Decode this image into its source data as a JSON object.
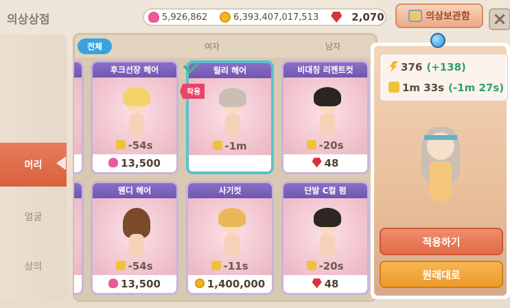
{
  "header": {
    "title": "의상상점",
    "hearts": "5,926,862",
    "coins": "6,393,407,017,513",
    "rubies": "2,070",
    "storage_label": "의상보관함",
    "close_symbol": "×"
  },
  "sidebar": {
    "items": [
      {
        "label": "머리",
        "active": true
      },
      {
        "label": "얼굴",
        "active": false
      },
      {
        "label": "상의",
        "active": false
      }
    ]
  },
  "tabs": [
    {
      "label": "전체",
      "active": true
    },
    {
      "label": "여자",
      "active": false
    },
    {
      "label": "남자",
      "active": false
    }
  ],
  "items": [
    {
      "name": "후크선장 헤어",
      "time": "-54s",
      "price": "13,500",
      "currency": "heart",
      "hair_color": "#f4d36a"
    },
    {
      "name": "릴리 헤어",
      "time": "-1m",
      "price": "",
      "currency": "",
      "hair_color": "#c9bfb5",
      "selected": true,
      "badge": "착용"
    },
    {
      "name": "비대칭 리젠트컷",
      "time": "-20s",
      "price": "48",
      "currency": "ruby",
      "hair_color": "#2b2421"
    },
    {
      "name": "웬디 헤어",
      "time": "-54s",
      "price": "13,500",
      "currency": "heart",
      "hair_color": "#7a4a2a"
    },
    {
      "name": "사기컷",
      "time": "-11s",
      "price": "1,400,000",
      "currency": "coin",
      "hair_color": "#e9b85a"
    },
    {
      "name": "단발 C컬 펌",
      "time": "-20s",
      "price": "48",
      "currency": "ruby",
      "hair_color": "#2f2624"
    }
  ],
  "preview": {
    "stat1_value": "376",
    "stat1_delta": "(+138)",
    "stat2_value": "1m 33s",
    "stat2_delta": "(-1m 27s)",
    "apply_label": "적용하기",
    "revert_label": "원래대로"
  },
  "colors": {
    "accent": "#3aa2de",
    "active_side": "#e26a48",
    "apply": "#e26a48",
    "revert": "#ee9a2a"
  }
}
